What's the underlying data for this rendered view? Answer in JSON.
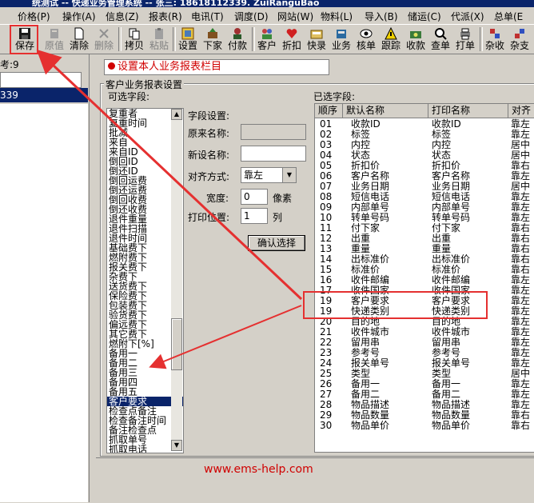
{
  "window": {
    "title": "统测试 -- 快递业务管理系统 -- 张三: 18618112339. ZuiRanguBao"
  },
  "menu": [
    "价格(P)",
    "操作(A)",
    "信息(Z)",
    "报表(R)",
    "电讯(T)",
    "调度(D)",
    "网站(W)",
    "物料(L)",
    "导入(B)",
    "储运(C)",
    "代派(X)",
    "总单(E"
  ],
  "toolbar": [
    {
      "label": "保存",
      "icon": "floppy-disk-icon",
      "enabled": true
    },
    {
      "label": "原值",
      "icon": "undo-value-icon",
      "enabled": false
    },
    {
      "label": "清除",
      "icon": "new-document-icon",
      "enabled": true
    },
    {
      "label": "删除",
      "icon": "delete-x-icon",
      "enabled": false
    },
    {
      "label": "拷贝",
      "icon": "copy-icon",
      "enabled": true
    },
    {
      "label": "粘贴",
      "icon": "paste-icon",
      "enabled": false
    },
    {
      "label": "设置",
      "icon": "settings-grid-icon",
      "enabled": true
    },
    {
      "label": "下家",
      "icon": "downstream-icon",
      "enabled": true
    },
    {
      "label": "付款",
      "icon": "payment-icon",
      "enabled": true
    },
    {
      "label": "客户",
      "icon": "customer-icon",
      "enabled": true
    },
    {
      "label": "折扣",
      "icon": "discount-heart-icon",
      "enabled": true
    },
    {
      "label": "快录",
      "icon": "quick-entry-icon",
      "enabled": true
    },
    {
      "label": "业务",
      "icon": "business-icon",
      "enabled": true
    },
    {
      "label": "核单",
      "icon": "verify-eye-icon",
      "enabled": true
    },
    {
      "label": "跟踪",
      "icon": "tracking-warning-icon",
      "enabled": true
    },
    {
      "label": "收款",
      "icon": "collect-money-icon",
      "enabled": true
    },
    {
      "label": "查单",
      "icon": "search-order-icon",
      "enabled": true
    },
    {
      "label": "打单",
      "icon": "print-order-icon",
      "enabled": true
    },
    {
      "label": "杂收",
      "icon": "misc-receive-icon",
      "enabled": true
    },
    {
      "label": "杂支",
      "icon": "misc-pay-icon",
      "enabled": true
    }
  ],
  "left": {
    "count_label": "考:9",
    "selected_row": "339"
  },
  "note": "设置本人业务报表栏目",
  "group_title": "客户业务报表设置",
  "available": {
    "label": "可选字段:",
    "items": [
      "复重者",
      "复重时间",
      "批减",
      "来自",
      "来自ID",
      "倒回ID",
      "倒还ID",
      "倒回运费",
      "倒还运费",
      "倒回收费",
      "倒还收费",
      "退件重量",
      "退件扫描",
      "退件时间",
      "基础费下",
      "燃附费下",
      "报关费下",
      "杂费下",
      "送货费下",
      "保险费下",
      "包装费下",
      "验货费下",
      "偏远费下",
      "其它费下",
      "燃附下[%]",
      "备用一",
      "备用二",
      "备用三",
      "备用四",
      "备用五",
      "客户要求",
      "检查点备注",
      "检查备注时间",
      "备注检查点",
      "抓取单号",
      "抓取电话"
    ],
    "selected": "客户要求"
  },
  "field_settings": {
    "title": "字段设置:",
    "original_name_label": "原来名称:",
    "original_name_value": "",
    "new_name_label": "新设名称:",
    "new_name_value": "",
    "align_label": "对齐方式:",
    "align_value": "靠左",
    "width_label": "宽度:",
    "width_value": "0",
    "width_unit": "像素",
    "print_pos_label": "打印位置:",
    "print_pos_value": "1",
    "print_pos_unit": "列",
    "confirm_label": "确认选择"
  },
  "chosen": {
    "label": "已选字段:",
    "columns": [
      "顺序",
      "默认名称",
      "打印名称",
      "对齐"
    ],
    "rows": [
      [
        "01",
        "收款ID",
        "收款ID",
        "靠左"
      ],
      [
        "02",
        "标签",
        "标签",
        "靠左"
      ],
      [
        "03",
        "内控",
        "内控",
        "居中"
      ],
      [
        "04",
        "状态",
        "状态",
        "居中"
      ],
      [
        "05",
        "折扣价",
        "折扣价",
        "靠右"
      ],
      [
        "06",
        "客户名称",
        "客户名称",
        "靠左"
      ],
      [
        "07",
        "业务日期",
        "业务日期",
        "居中"
      ],
      [
        "08",
        "短信电话",
        "短信电话",
        "靠左"
      ],
      [
        "09",
        "内部单号",
        "内部单号",
        "靠左"
      ],
      [
        "10",
        "转单号码",
        "转单号码",
        "靠左"
      ],
      [
        "11",
        "付下家",
        "付下家",
        "靠右"
      ],
      [
        "12",
        "出重",
        "出重",
        "靠右"
      ],
      [
        "13",
        "重量",
        "重量",
        "靠右"
      ],
      [
        "14",
        "出标准价",
        "出标准价",
        "靠右"
      ],
      [
        "15",
        "标准价",
        "标准价",
        "靠右"
      ],
      [
        "16",
        "收件邮编",
        "收件邮编",
        "靠左"
      ],
      [
        "17",
        "收件国家",
        "收件国家",
        "靠左"
      ],
      [
        "19",
        "客户要求",
        "客户要求",
        "靠左"
      ],
      [
        "19",
        "快递类别",
        "快递类别",
        "靠左"
      ],
      [
        "20",
        "目的地",
        "目的地",
        "靠左"
      ],
      [
        "21",
        "收件城市",
        "收件城市",
        "靠左"
      ],
      [
        "22",
        "留用串",
        "留用串",
        "靠左"
      ],
      [
        "23",
        "参考号",
        "参考号",
        "靠左"
      ],
      [
        "24",
        "报关单号",
        "报关单号",
        "靠左"
      ],
      [
        "25",
        "类型",
        "类型",
        "居中"
      ],
      [
        "26",
        "备用一",
        "备用一",
        "靠左"
      ],
      [
        "27",
        "备用二",
        "备用二",
        "靠左"
      ],
      [
        "28",
        "物品描述",
        "物品描述",
        "靠左"
      ],
      [
        "29",
        "物品数量",
        "物品数量",
        "靠右"
      ],
      [
        "30",
        "物品单价",
        "物品单价",
        "靠右"
      ]
    ]
  },
  "watermark": "www.ems-help.com",
  "annotation_color": "#e53030"
}
